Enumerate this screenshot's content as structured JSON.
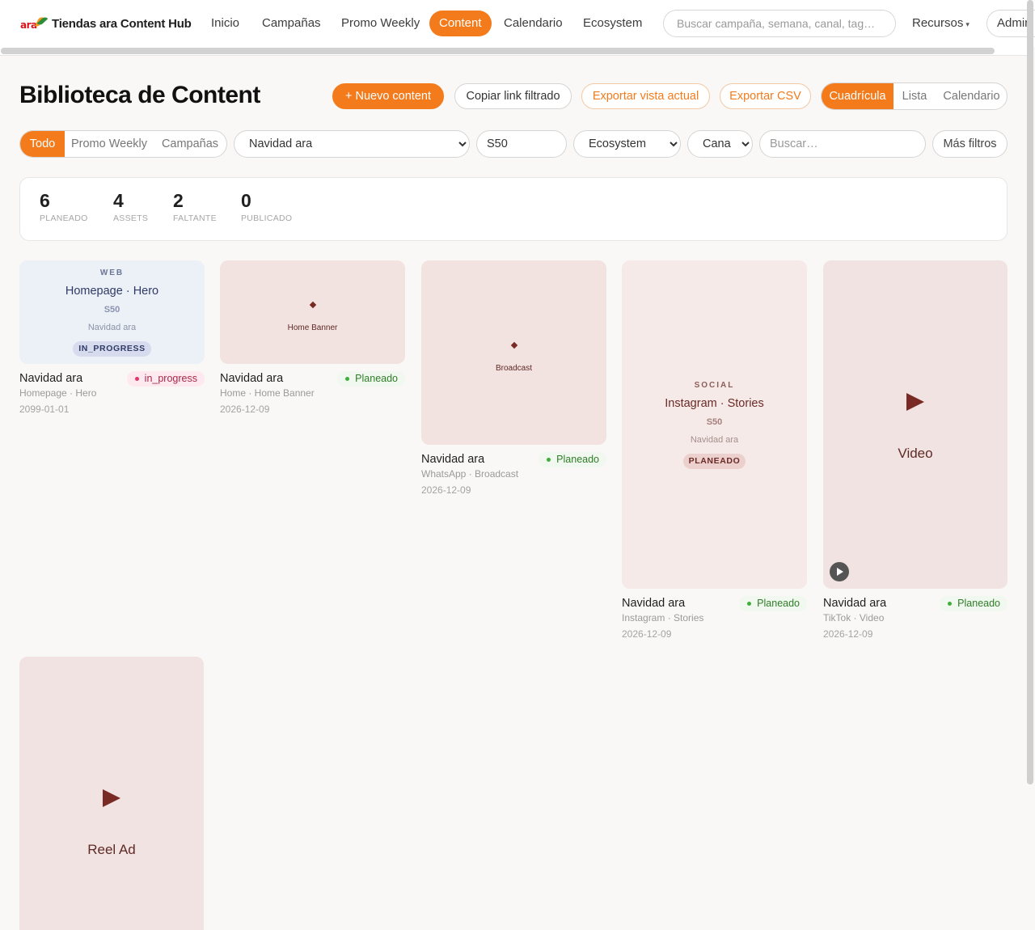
{
  "nav": {
    "brand_logo_text": "ara",
    "brand_name": "Tiendas ara Content Hub",
    "items": [
      "Inicio",
      "Campañas",
      "Promo Weekly",
      "Content",
      "Calendario",
      "Ecosystem"
    ],
    "active": "Content",
    "search_placeholder": "Buscar campaña, semana, canal, tag…",
    "resources_label": "Recursos",
    "resources_caret": "▾",
    "admin_label": "Admin"
  },
  "header": {
    "title": "Biblioteca de Content",
    "new_content": "+ Nuevo content",
    "copy_link": "Copiar link filtrado",
    "export_view": "Exportar vista actual",
    "export_csv": "Exportar CSV",
    "views": [
      "Cuadrícula",
      "Lista",
      "Calendario"
    ],
    "active_view": "Cuadrícula"
  },
  "filters": {
    "scope": [
      "Todo",
      "Promo Weekly",
      "Campañas"
    ],
    "active_scope": "Todo",
    "campaign_value": "Navidad ara",
    "week_value": "S50",
    "ecosystem_value": "Ecosystem",
    "channel_value": "Canal",
    "search_placeholder": "Buscar…",
    "more_filters": "Más filtros"
  },
  "stats": [
    {
      "value": "6",
      "label": "PLANEADO"
    },
    {
      "value": "4",
      "label": "ASSETS"
    },
    {
      "value": "2",
      "label": "FALTANTE"
    },
    {
      "value": "0",
      "label": "PUBLICADO"
    }
  ],
  "cards": [
    {
      "thumb": {
        "eyebrow": "WEB",
        "title": "Homepage · Hero",
        "week": "S50",
        "campaign": "Navidad ara",
        "pill": "IN_PROGRESS"
      },
      "title": "Navidad ara",
      "status": "in_progress",
      "subtitle": "Homepage · Hero",
      "date": "2099-01-01"
    },
    {
      "thumb": {
        "label": "Home Banner",
        "icon": "diamond-icon"
      },
      "title": "Navidad ara",
      "status": "Planeado",
      "subtitle": "Home · Home Banner",
      "date": "2026-12-09"
    },
    {
      "thumb": {
        "label": "Broadcast",
        "icon": "diamond-icon"
      },
      "title": "Navidad ara",
      "status": "Planeado",
      "subtitle": "WhatsApp · Broadcast",
      "date": "2026-12-09"
    },
    {
      "thumb": {
        "eyebrow": "SOCIAL",
        "title": "Instagram · Stories",
        "week": "S50",
        "campaign": "Navidad ara",
        "pill": "PLANEADO"
      },
      "title": "Navidad ara",
      "status": "Planeado",
      "subtitle": "Instagram · Stories",
      "date": "2026-12-09"
    },
    {
      "thumb": {
        "label": "Video",
        "icon": "play-icon"
      },
      "title": "Navidad ara",
      "status": "Planeado",
      "subtitle": "TikTok · Video",
      "date": "2026-12-09"
    },
    {
      "thumb": {
        "label": "Reel Ad",
        "icon": "play-icon"
      },
      "title": "",
      "status": "",
      "subtitle": "",
      "date": ""
    }
  ],
  "colors": {
    "accent": "#f47b1c",
    "planeado_text": "#2f7d28",
    "in_progress_text": "#a8284a",
    "thumb_rose": "#f2e2e0",
    "thumb_blue": "#ecf0f7"
  }
}
